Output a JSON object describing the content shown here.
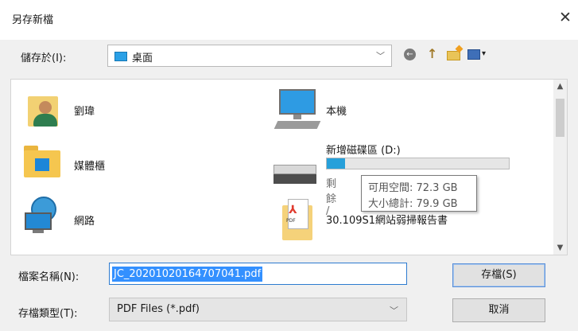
{
  "window": {
    "title": "另存新檔",
    "close_symbol": "✕"
  },
  "toolbar": {
    "save_in_label": "儲存於(I):",
    "location": "桌面",
    "dropdown_symbol": "﹀",
    "back_symbol": "←",
    "up_symbol": "↑",
    "views_caret": "▾"
  },
  "items": [
    {
      "label": "劉瑋",
      "icon": "user-folder-icon"
    },
    {
      "label": "媒體櫃",
      "icon": "libraries-folder-icon"
    },
    {
      "label": "網路",
      "icon": "network-icon"
    },
    {
      "label": "本機",
      "icon": "this-pc-icon"
    },
    {
      "label": "新增磁碟區 (D:)",
      "icon": "hard-drive-icon",
      "free_text": "剩餘 /",
      "used_fraction": 0.1
    },
    {
      "label": "30.109S1網站弱掃報告書",
      "icon": "pdf-folder-icon"
    }
  ],
  "tooltip": {
    "free_space": "可用空間: 72.3 GB",
    "total_size": "大小總計: 79.9 GB"
  },
  "scrollbar": {
    "up_symbol": "▲",
    "down_symbol": "▼"
  },
  "filename": {
    "label": "檔案名稱(N):",
    "value": "JC_20201020164707041.pdf"
  },
  "filetype": {
    "label": "存檔類型(T):",
    "value": "PDF Files (*.pdf)",
    "dropdown_symbol": "﹀"
  },
  "buttons": {
    "save": "存檔(S)",
    "cancel": "取消"
  },
  "pdf_tag": "PDF",
  "pdf_symbol": "⅄",
  "colors": {
    "selection": "#3390ff",
    "drive_bar": "#26a0da",
    "focus_border": "#2d7bd0"
  }
}
